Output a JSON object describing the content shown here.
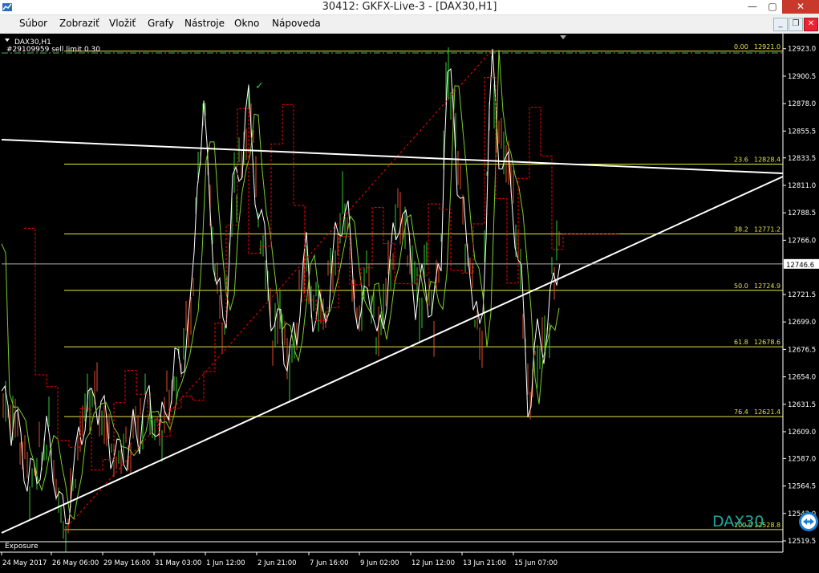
{
  "window": {
    "title": "30412: GKFX-Live-3 - [DAX30,H1]",
    "min": "—",
    "max": "▢",
    "close": "✕"
  },
  "menu": [
    {
      "label": "Súbor"
    },
    {
      "label": "Zobraziť"
    },
    {
      "label": "Vložiť"
    },
    {
      "label": "Grafy"
    },
    {
      "label": "Nástroje"
    },
    {
      "label": "Okno"
    },
    {
      "label": "Nápoveda"
    }
  ],
  "chart": {
    "symbol": "DAX30,H1",
    "order": "#29109959 sell limit 0.30",
    "watermark": "DAX30",
    "subwindow": "Exposure",
    "current_price_label": "12746.6",
    "colors": {
      "background": "#000000",
      "candle_up": "#32cd32",
      "candle_down": "#e0502a",
      "fib": "#e6e64a",
      "trend": "#ffffff",
      "price_line": "#b0b0b0",
      "stop_line": "#ff0000",
      "ma_green": "#7ccd2a"
    }
  },
  "chart_data": {
    "type": "candlestick",
    "symbol": "DAX30",
    "timeframe": "H1",
    "y_ticks": [
      12923.0,
      12900.5,
      12878.0,
      12855.5,
      12833.5,
      12811.0,
      12788.5,
      12766.0,
      12743.5,
      12721.5,
      12699.0,
      12676.5,
      12654.0,
      12631.5,
      12609.0,
      12587.0,
      12564.5,
      12542.0,
      12519.5
    ],
    "x_ticks": [
      "24 May 2017",
      "26 May 06:00",
      "29 May 16:00",
      "31 May 03:00",
      "1 Jun 12:00",
      "2 Jun 21:00",
      "7 Jun 16:00",
      "9 Jun 02:00",
      "12 Jun 12:00",
      "13 Jun 21:00",
      "15 Jun 07:00"
    ],
    "ylim": [
      12519.5,
      12934.0
    ],
    "fib_levels": [
      {
        "pct": "0.00",
        "price": "12921.0",
        "value": 12921.0
      },
      {
        "pct": "23.6",
        "price": "12828.4",
        "value": 12828.4
      },
      {
        "pct": "38.2",
        "price": "12771.2",
        "value": 12771.2
      },
      {
        "pct": "50.0",
        "price": "12724.9",
        "value": 12724.9
      },
      {
        "pct": "61.8",
        "price": "12678.6",
        "value": 12678.6
      },
      {
        "pct": "76.4",
        "price": "12621.4",
        "value": 12621.4
      },
      {
        "pct": "100.0",
        "price": "12528.8",
        "value": 12528.8
      }
    ],
    "current_price": 12746.6,
    "price_path": [
      [
        0,
        12640
      ],
      [
        20,
        12620
      ],
      [
        40,
        12560
      ],
      [
        60,
        12610
      ],
      [
        80,
        12530
      ],
      [
        100,
        12610
      ],
      [
        120,
        12640
      ],
      [
        140,
        12600
      ],
      [
        160,
        12590
      ],
      [
        180,
        12630
      ],
      [
        200,
        12610
      ],
      [
        220,
        12660
      ],
      [
        240,
        12710
      ],
      [
        245,
        12830
      ],
      [
        255,
        12860
      ],
      [
        265,
        12770
      ],
      [
        270,
        12730
      ],
      [
        280,
        12700
      ],
      [
        290,
        12800
      ],
      [
        300,
        12830
      ],
      [
        310,
        12880
      ],
      [
        320,
        12800
      ],
      [
        330,
        12760
      ],
      [
        340,
        12690
      ],
      [
        350,
        12700
      ],
      [
        360,
        12660
      ],
      [
        370,
        12700
      ],
      [
        380,
        12760
      ],
      [
        390,
        12710
      ],
      [
        400,
        12700
      ],
      [
        410,
        12730
      ],
      [
        420,
        12760
      ],
      [
        430,
        12800
      ],
      [
        440,
        12730
      ],
      [
        450,
        12700
      ],
      [
        460,
        12740
      ],
      [
        470,
        12680
      ],
      [
        480,
        12720
      ],
      [
        490,
        12760
      ],
      [
        500,
        12790
      ],
      [
        510,
        12760
      ],
      [
        520,
        12710
      ],
      [
        530,
        12740
      ],
      [
        540,
        12700
      ],
      [
        550,
        12760
      ],
      [
        555,
        12880
      ],
      [
        560,
        12910
      ],
      [
        570,
        12830
      ],
      [
        580,
        12760
      ],
      [
        590,
        12730
      ],
      [
        600,
        12660
      ],
      [
        605,
        12770
      ],
      [
        612,
        12921
      ],
      [
        620,
        12850
      ],
      [
        630,
        12830
      ],
      [
        640,
        12800
      ],
      [
        650,
        12730
      ],
      [
        655,
        12680
      ],
      [
        660,
        12620
      ],
      [
        665,
        12660
      ],
      [
        675,
        12690
      ],
      [
        685,
        12700
      ],
      [
        695,
        12760
      ]
    ]
  }
}
